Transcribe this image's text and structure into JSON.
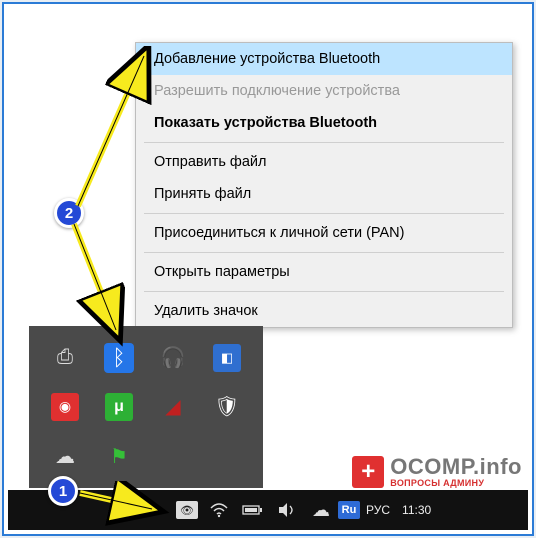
{
  "menu": {
    "items": [
      {
        "label": "Добавление устройства Bluetooth",
        "highlighted": true
      },
      {
        "label": "Разрешить подключение устройства",
        "disabled": true
      },
      {
        "label": "Показать устройства Bluetooth",
        "bold": true
      },
      {
        "sep": true
      },
      {
        "label": "Отправить файл"
      },
      {
        "label": "Принять файл"
      },
      {
        "sep": true
      },
      {
        "label": "Присоединиться к личной сети (PAN)"
      },
      {
        "sep": true
      },
      {
        "label": "Открыть параметры"
      },
      {
        "sep": true
      },
      {
        "label": "Удалить значок"
      }
    ]
  },
  "tray": {
    "icons": [
      {
        "name": "usb-drive-icon",
        "glyph": "🔌",
        "color": "#ddd"
      },
      {
        "name": "bluetooth-icon",
        "glyph": "ᛒ",
        "bluetooth": true
      },
      {
        "name": "headphones-icon",
        "glyph": "🎧",
        "color": "#888"
      },
      {
        "name": "intel-graphics-icon",
        "glyph": "⬛",
        "color": "#2f6fd0"
      },
      {
        "name": "screen-capture-icon",
        "glyph": "◉",
        "color": "#e03030"
      },
      {
        "name": "utorrent-icon",
        "glyph": "μ",
        "color": "#2db035"
      },
      {
        "name": "antivirus-icon",
        "glyph": "▲",
        "color": "#c02020"
      },
      {
        "name": "defender-icon",
        "glyph": "🛡",
        "color": "#f5ca20"
      },
      {
        "name": "cloud-icon",
        "glyph": "☁",
        "color": "#ddd"
      },
      {
        "name": "flag-icon",
        "glyph": "⚑",
        "color": "#35c038"
      }
    ]
  },
  "taskbar": {
    "tray_items": [
      {
        "name": "overflow-chevron-icon"
      },
      {
        "name": "monitor-icon",
        "glyph": "🖥"
      },
      {
        "name": "wifi-icon",
        "glyph": "📶"
      },
      {
        "name": "battery-icon",
        "glyph": "🔋"
      },
      {
        "name": "volume-icon",
        "glyph": "🔊"
      },
      {
        "name": "onedrive-icon",
        "glyph": "☁"
      }
    ],
    "lang_badge": "Ru",
    "lang_text": "РУС",
    "clock": "11:30"
  },
  "steps": {
    "one": "1",
    "two": "2"
  },
  "watermark": {
    "cross": "+",
    "title": "OCOMP.info",
    "subtitle": "ВОПРОСЫ АДМИНУ"
  }
}
